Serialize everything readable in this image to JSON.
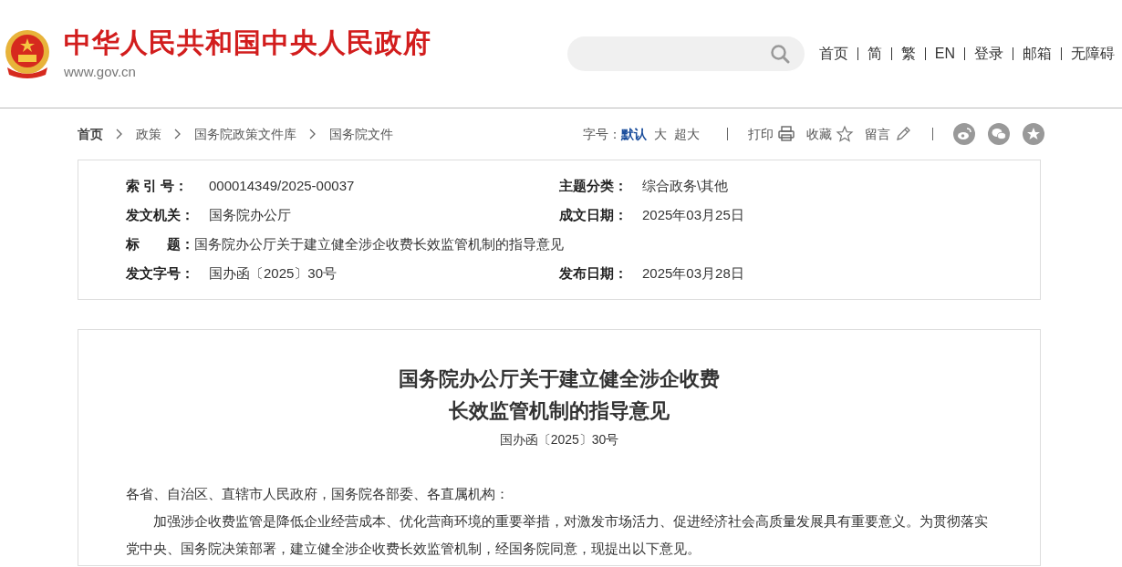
{
  "header": {
    "site_title": "中华人民共和国中央人民政府",
    "site_url": "www.gov.cn",
    "nav": [
      "首页",
      "简",
      "繁",
      "EN",
      "登录",
      "邮箱",
      "无障碍"
    ]
  },
  "breadcrumb": [
    "首页",
    "政策",
    "国务院政策文件库",
    "国务院文件"
  ],
  "toolbar": {
    "font_size_label": "字号：",
    "font_sizes": [
      {
        "label": "默认",
        "selected": true
      },
      {
        "label": "大",
        "selected": false
      },
      {
        "label": "超大",
        "selected": false
      }
    ],
    "actions": [
      {
        "kind": "print",
        "label": "打印"
      },
      {
        "kind": "favorite",
        "label": "收藏"
      },
      {
        "kind": "comment",
        "label": "留言"
      }
    ],
    "share": [
      {
        "kind": "weibo"
      },
      {
        "kind": "wechat"
      },
      {
        "kind": "star"
      }
    ]
  },
  "meta": [
    {
      "label": "索 引 号：",
      "value": "000014349/2025-00037",
      "label2": "主题分类：",
      "value2": "综合政务\\其他"
    },
    {
      "label": "发文机关：",
      "value": "国务院办公厅",
      "label2": "成文日期：",
      "value2": "2025年03月25日"
    },
    {
      "label": "标　　题：",
      "value": "国务院办公厅关于建立健全涉企收费长效监管机制的指导意见"
    },
    {
      "label": "发文字号：",
      "value": "国办函〔2025〕30号",
      "label2": "发布日期：",
      "value2": "2025年03月28日"
    }
  ],
  "article": {
    "title_lines": [
      "国务院办公厅关于建立健全涉企收费",
      "长效监管机制的指导意见"
    ],
    "doc_number": "国办函〔2025〕30号",
    "salutation": "各省、自治区、直辖市人民政府，国务院各部委、各直属机构：",
    "paragraphs": [
      "加强涉企收费监管是降低企业经营成本、优化营商环境的重要举措，对激发市场活力、促进经济社会高质量发展具有重要意义。为贯彻落实党中央、国务院决策部署，建立健全涉企收费长效监管机制，经国务院同意，现提出以下意见。"
    ]
  }
}
